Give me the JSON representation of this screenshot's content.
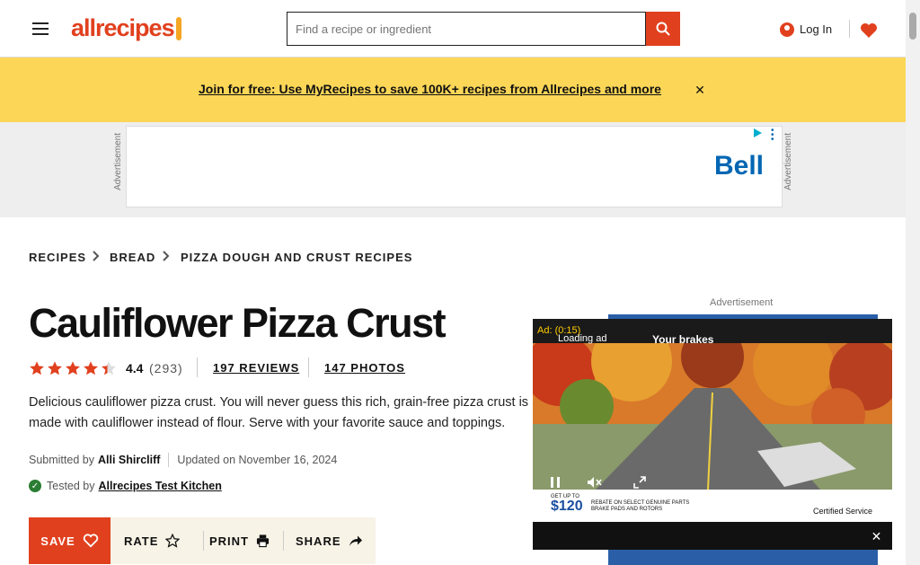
{
  "header": {
    "logo_text": "allrecipes",
    "search_placeholder": "Find a recipe or ingredient",
    "login_label": "Log In"
  },
  "promo": {
    "text": "Join for free: Use MyRecipes to save 100K+ recipes from Allrecipes and more",
    "close_glyph": "✕"
  },
  "top_ad": {
    "label": "Advertisement",
    "brand": "Bell"
  },
  "breadcrumb": [
    "Recipes",
    "Bread",
    "Pizza Dough and Crust Recipes"
  ],
  "recipe": {
    "title": "Cauliflower Pizza Crust",
    "rating_value": "4.4",
    "rating_stars": 4.4,
    "rating_count": "(293)",
    "reviews_label": "197 Reviews",
    "photos_label": "147 Photos",
    "description": "Delicious cauliflower pizza crust. You will never guess this rich, grain-free pizza crust is made with cauliflower instead of flour. Serve with your favorite sauce and toppings.",
    "submitted_prefix": "Submitted by",
    "author": "Alli Shircliff",
    "updated": "Updated on November 16, 2024",
    "tested_prefix": "Tested by",
    "tested_by": "Allrecipes Test Kitchen"
  },
  "actions": {
    "save": "Save",
    "rate": "Rate",
    "print": "Print",
    "share": "Share"
  },
  "side_ad": {
    "label": "Advertisement",
    "timer": "Ad: (0:15)",
    "loading": "Loading ad",
    "headline": "Your brakes",
    "price_prefix": "GET UP TO",
    "price": "$120",
    "promo_text": "REBATE ON SELECT GENUINE PARTS BRAKE PADS AND ROTORS",
    "cert": "Certified Service",
    "close_glyph": "✕"
  },
  "colors": {
    "brand": "#e1401e",
    "promo_bg": "#fcd757",
    "star": "#e1401e"
  }
}
